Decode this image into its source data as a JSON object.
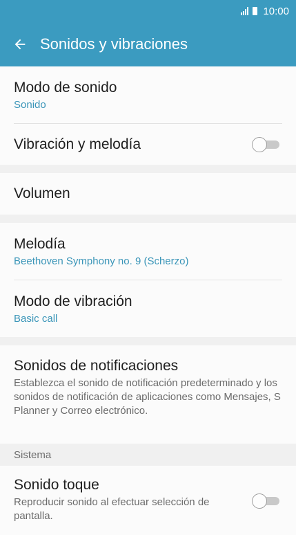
{
  "status": {
    "time": "10:00"
  },
  "appbar": {
    "title": "Sonidos y vibraciones"
  },
  "items": {
    "sound_mode": {
      "title": "Modo de sonido",
      "value": "Sonido"
    },
    "vibrate_ring": {
      "title": "Vibración y melodía",
      "toggle": "off"
    },
    "volume": {
      "title": "Volumen"
    },
    "ringtone": {
      "title": "Melodía",
      "value": "Beethoven Symphony no. 9 (Scherzo)"
    },
    "vibration_pattern": {
      "title": "Modo de vibración",
      "value": "Basic call"
    },
    "notification_sounds": {
      "title": "Sonidos de notificaciones",
      "desc": "Establezca el sonido de notificación predeterminado y los sonidos de notificación de aplicaciones como Mensajes, S Planner y Correo electrónico."
    },
    "system_header": "Sistema",
    "touch_sound": {
      "title": "Sonido toque",
      "desc": "Reproducir sonido al efectuar selección de pantalla.",
      "toggle": "off"
    }
  }
}
